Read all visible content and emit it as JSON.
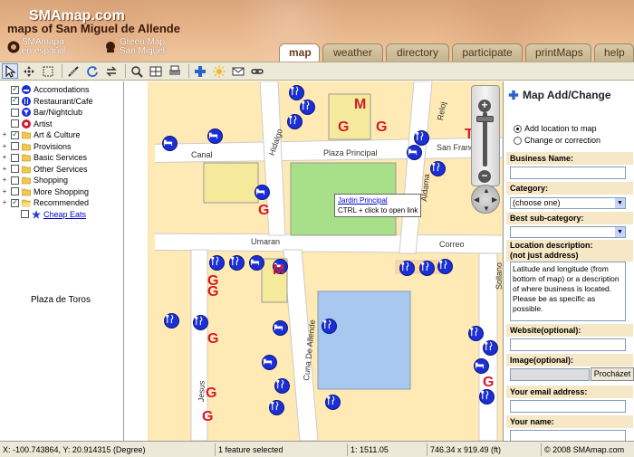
{
  "header": {
    "site_title": "SMAmap.com",
    "site_subtitle": "maps of San Miguel de Allende",
    "link_spanish_line1": "SMAmapa",
    "link_spanish_line2": "en español",
    "link_green_line1": "Green Map",
    "link_green_line2": "San Miguel"
  },
  "tabs": [
    {
      "label": "map",
      "active": true
    },
    {
      "label": "weather",
      "active": false
    },
    {
      "label": "directory",
      "active": false
    },
    {
      "label": "participate",
      "active": false
    },
    {
      "label": "printMaps",
      "active": false
    },
    {
      "label": "help",
      "active": false
    }
  ],
  "toolbar": {
    "tools": [
      "pointer-tool-icon",
      "pan-tool-icon",
      "select-box-icon",
      "measure-icon",
      "refresh-icon",
      "swap-icon",
      "zoom-icon",
      "grid-icon",
      "print-icon",
      "add-location-icon",
      "sun-icon",
      "email-icon",
      "link-icon"
    ]
  },
  "layers": [
    {
      "name": "Accomodations",
      "checked": true,
      "expand": false,
      "icon": "bed-icon",
      "link": false
    },
    {
      "name": "Restaurant/Café",
      "checked": true,
      "expand": false,
      "icon": "fork-knife-icon",
      "link": false
    },
    {
      "name": "Bar/Nightclub",
      "checked": false,
      "expand": false,
      "icon": "glass-icon",
      "link": false
    },
    {
      "name": "Artist",
      "checked": false,
      "expand": false,
      "icon": "palette-icon",
      "link": false
    },
    {
      "name": "Art & Culture",
      "checked": true,
      "expand": true,
      "icon": "folder-icon",
      "link": false
    },
    {
      "name": "Provisions",
      "checked": false,
      "expand": true,
      "icon": "folder-icon",
      "link": false
    },
    {
      "name": "Basic Services",
      "checked": false,
      "expand": true,
      "icon": "folder-icon",
      "link": false
    },
    {
      "name": "Other Services",
      "checked": false,
      "expand": true,
      "icon": "folder-icon",
      "link": false
    },
    {
      "name": "Shopping",
      "checked": false,
      "expand": true,
      "icon": "folder-icon",
      "link": false
    },
    {
      "name": "More Shopping",
      "checked": false,
      "expand": true,
      "icon": "folder-icon",
      "link": false
    },
    {
      "name": "Recommended",
      "checked": true,
      "expand": true,
      "icon": "open-folder-icon",
      "link": false
    },
    {
      "name": "Cheap Eats",
      "checked": false,
      "expand": false,
      "icon": "star-icon",
      "link": true
    }
  ],
  "map": {
    "side_label": "Plaza de Toros",
    "streets": {
      "canal": "Canal",
      "plaza_principal": "Plaza Principal",
      "hidalgo": "Hidalgo",
      "reloj": "Reloj",
      "san_francisco": "San Francisco",
      "umaran": "Umaran",
      "correo": "Correo",
      "cuna_de_allende": "Cuna De Allende",
      "jesus": "Jesus",
      "aldama": "Aldama",
      "sollano": "Sollano"
    },
    "tooltip_title": "Jardin Principal",
    "tooltip_hint": "CTRL + click to open link",
    "letters": {
      "m": "M",
      "g": "G",
      "t": "T"
    },
    "zoom_plus": "+",
    "zoom_minus": "−"
  },
  "panel": {
    "title": "Map Add/Change",
    "radio_add": "Add location to map",
    "radio_change": "Change or correction",
    "business_name_label": "Business Name:",
    "category_label": "Category:",
    "category_value": "(choose one)",
    "subcategory_label": "Best sub-category:",
    "location_label_line1": "Location description:",
    "location_label_line2": "(not just address)",
    "location_text": "Latitude and longitude (from bottom of map) or a description of where business is located. Please be as specific as possible.",
    "website_label": "Website(optional):",
    "image_label": "Image(optional):",
    "browse_label": "Procházet",
    "email_label": "Your email address:",
    "name_label": "Your name:"
  },
  "status": {
    "coords": "X: -100.743864, Y: 20.914315 (Degree)",
    "selection": "1 feature selected",
    "scale": "1: 1511.05",
    "extent": "746.34 x 919.49 (ft)",
    "copyright": "© 2008 SMAmap.com"
  },
  "colors": {
    "poi_blue": "#1b2fd6",
    "letter_red": "#d21b2d",
    "block_tan": "#ffe9b5",
    "park_green": "#a8e08a",
    "water_blue": "#a9c8f0",
    "building_yellow": "#f5ea9c"
  }
}
